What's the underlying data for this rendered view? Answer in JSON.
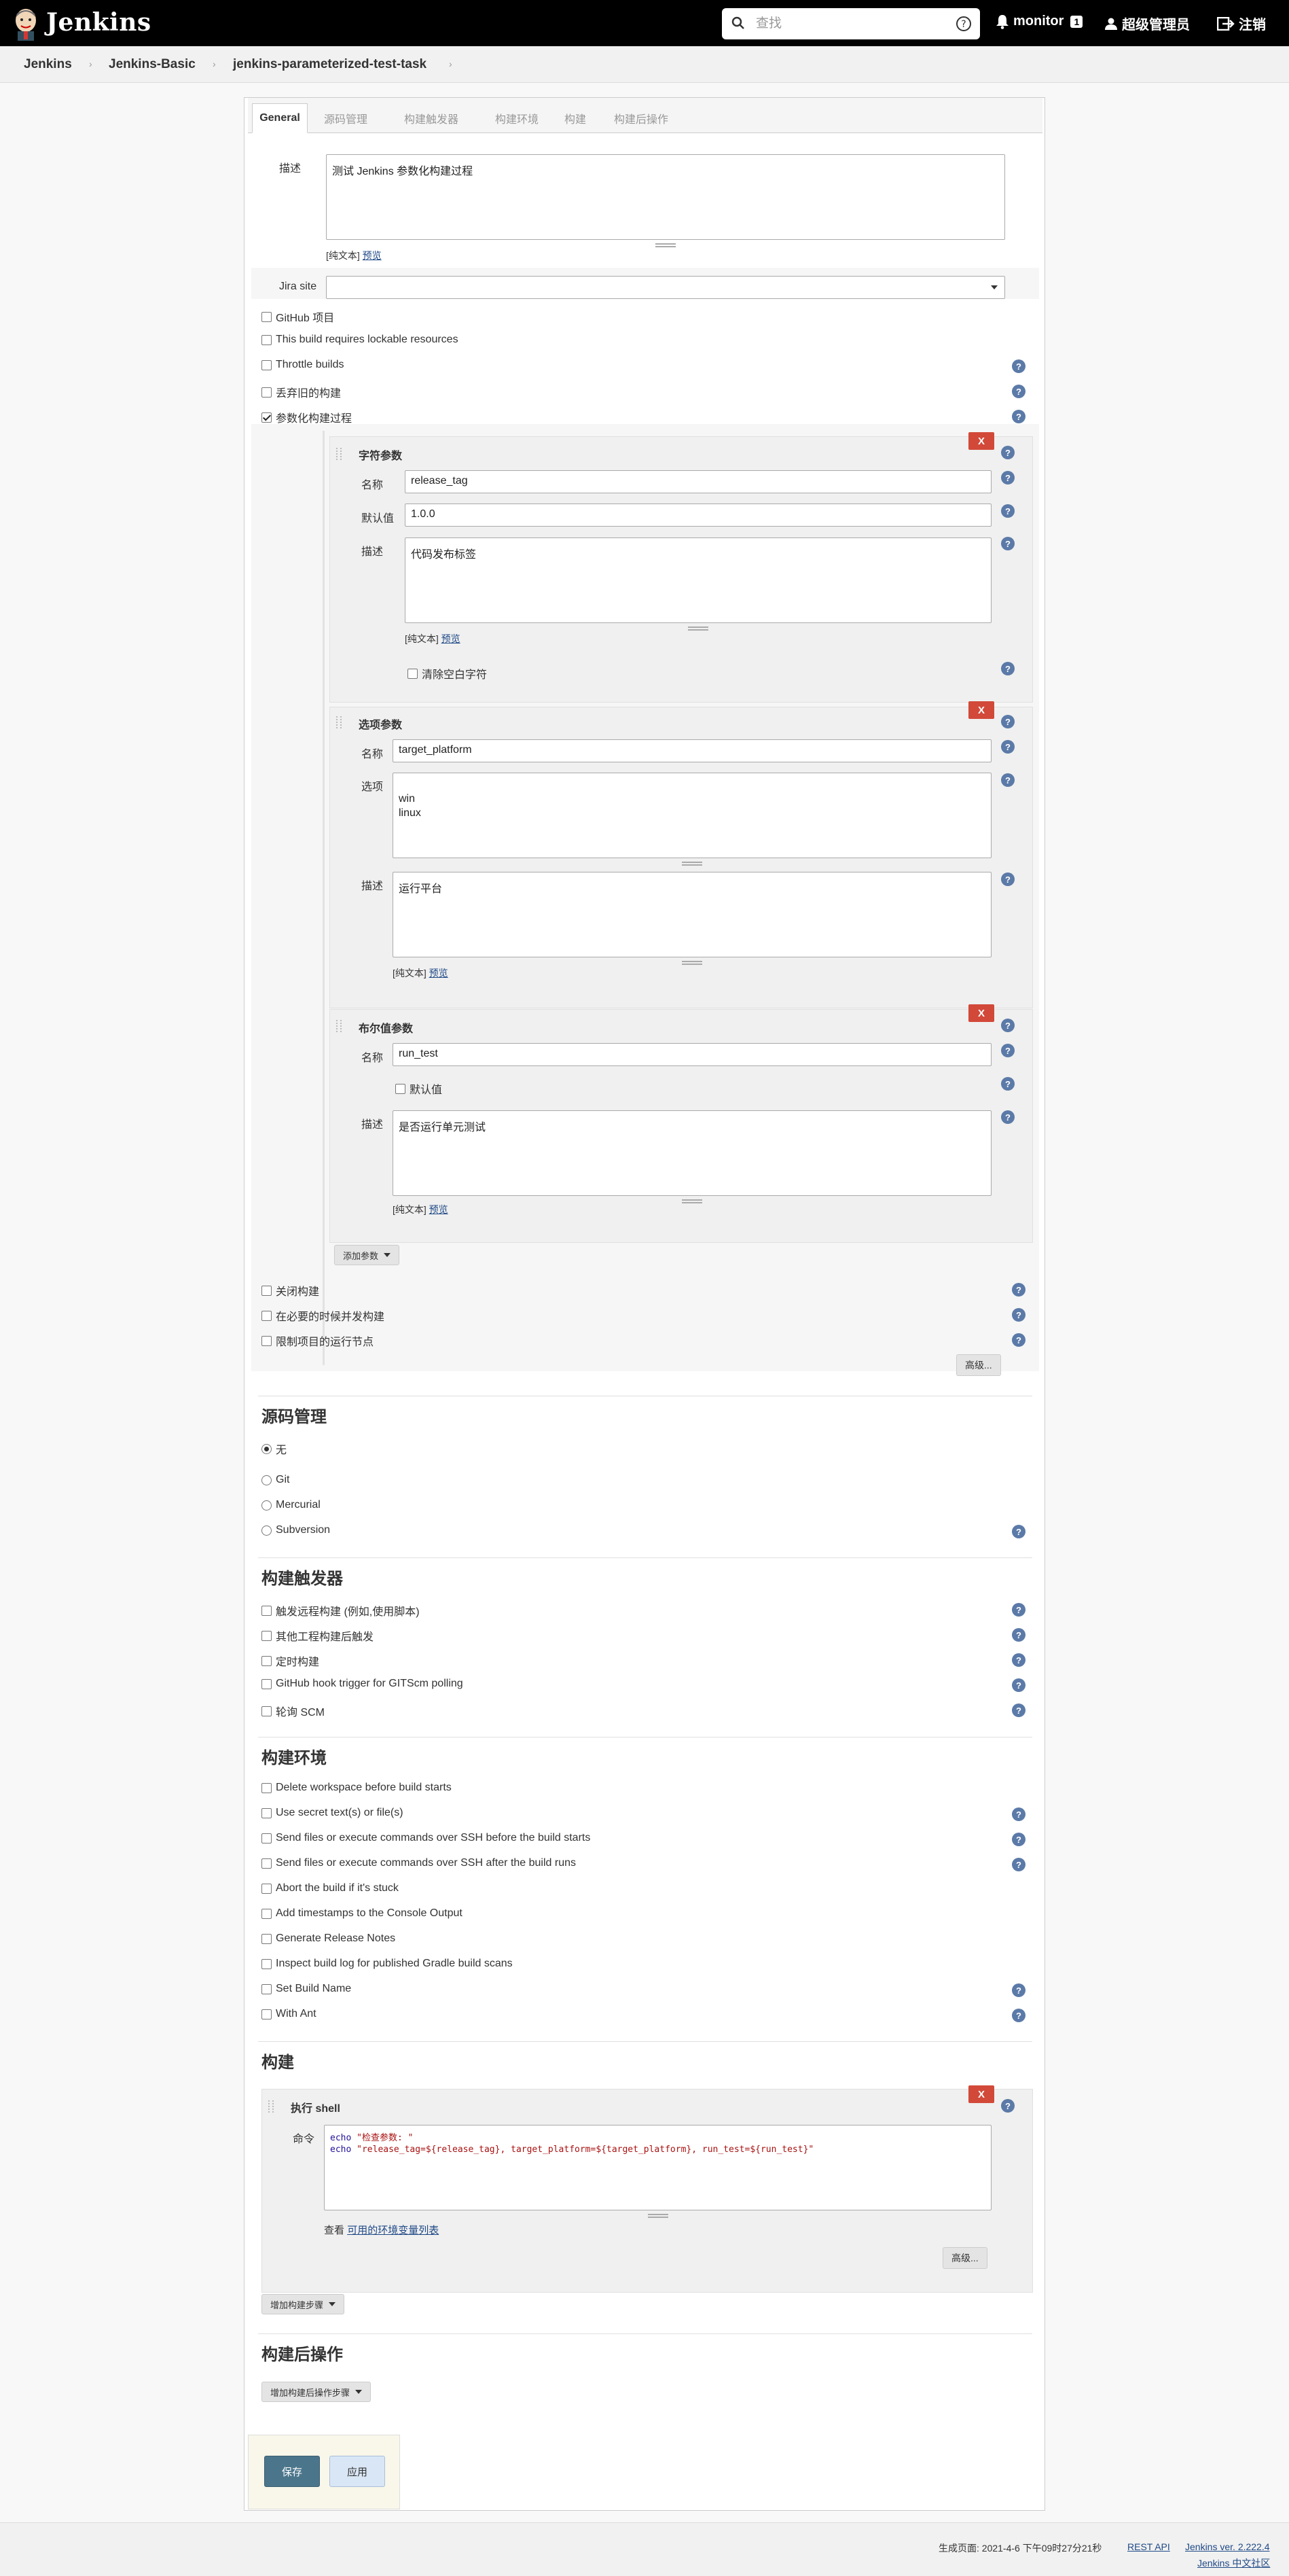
{
  "header": {
    "logo_text": "Jenkins",
    "search_placeholder": "查找",
    "notifications_label": "monitor",
    "notifications_count": "1",
    "user_label": "超级管理员",
    "logout_label": "注销"
  },
  "breadcrumbs": [
    "Jenkins",
    "Jenkins-Basic",
    "jenkins-parameterized-test-task"
  ],
  "tabs": [
    "General",
    "源码管理",
    "构建触发器",
    "构建环境",
    "构建",
    "构建后操作"
  ],
  "general": {
    "description_label": "描述",
    "description_value": "测试 Jenkins 参数化构建过程",
    "plain_text": "[纯文本]",
    "preview": "预览",
    "jira_site_label": "Jira site",
    "options": [
      {
        "label": "GitHub 项目",
        "checked": false
      },
      {
        "label": "This build requires lockable resources",
        "checked": false
      },
      {
        "label": "Throttle builds",
        "checked": false
      },
      {
        "label": "丢弃旧的构建",
        "checked": false
      },
      {
        "label": "参数化构建过程",
        "checked": true
      }
    ],
    "params": {
      "string": {
        "title": "字符参数",
        "name_label": "名称",
        "name_value": "release_tag",
        "default_label": "默认值",
        "default_value": "1.0.0",
        "desc_label": "描述",
        "desc_value": "代码发布标签",
        "trim_label": "清除空白字符"
      },
      "choice": {
        "title": "选项参数",
        "name_label": "名称",
        "name_value": "target_platform",
        "choices_label": "选项",
        "choices_value": "win\nlinux",
        "desc_label": "描述",
        "desc_value": "运行平台"
      },
      "boolean": {
        "title": "布尔值参数",
        "name_label": "名称",
        "name_value": "run_test",
        "default_label": "默认值",
        "desc_label": "描述",
        "desc_value": "是否运行单元测试"
      },
      "delete_label": "X",
      "add_param_label": "添加参数"
    },
    "more_options": [
      {
        "label": "关闭构建",
        "checked": false
      },
      {
        "label": "在必要的时候并发构建",
        "checked": false
      },
      {
        "label": "限制项目的运行节点",
        "checked": false
      }
    ],
    "advanced_label": "高级..."
  },
  "scm": {
    "title": "源码管理",
    "options": [
      {
        "label": "无",
        "checked": true
      },
      {
        "label": "Git",
        "checked": false
      },
      {
        "label": "Mercurial",
        "checked": false
      },
      {
        "label": "Subversion",
        "checked": false
      }
    ]
  },
  "triggers": {
    "title": "构建触发器",
    "options": [
      "触发远程构建 (例如,使用脚本)",
      "其他工程构建后触发",
      "定时构建",
      "GitHub hook trigger for GITScm polling",
      "轮询 SCM"
    ]
  },
  "environment": {
    "title": "构建环境",
    "options": [
      "Delete workspace before build starts",
      "Use secret text(s) or file(s)",
      "Send files or execute commands over SSH before the build starts",
      "Send files or execute commands over SSH after the build runs",
      "Abort the build if it's stuck",
      "Add timestamps to the Console Output",
      "Generate Release Notes",
      "Inspect build log for published Gradle build scans",
      "Set Build Name",
      "With Ant"
    ]
  },
  "build": {
    "title": "构建",
    "step_title": "执行 shell",
    "command_label": "命令",
    "code_line1_cmd": "echo ",
    "code_line1_str": "\"检查参数: \"",
    "code_line2_cmd": "echo ",
    "code_line2_str": "\"release_tag=${release_tag}, target_platform=${target_platform}, run_test=${run_test}\"",
    "env_hint_prefix": "查看",
    "env_hint_link": "可用的环境变量列表",
    "advanced_label": "高级...",
    "add_step_label": "增加构建步骤"
  },
  "post_build": {
    "title": "构建后操作",
    "add_step_label": "增加构建后操作步骤"
  },
  "actions": {
    "save": "保存",
    "apply": "应用"
  },
  "footer": {
    "generated": "生成页面: 2021-4-6 下午09时27分21秒",
    "rest_api": "REST API",
    "version": "Jenkins ver. 2.222.4",
    "community": "Jenkins 中文社区"
  },
  "colors": {
    "header_bg": "#000000",
    "help_icon": "#5b7aa8",
    "delete_btn": "#d24939",
    "save_btn": "#4b758b",
    "link": "#204a87"
  }
}
